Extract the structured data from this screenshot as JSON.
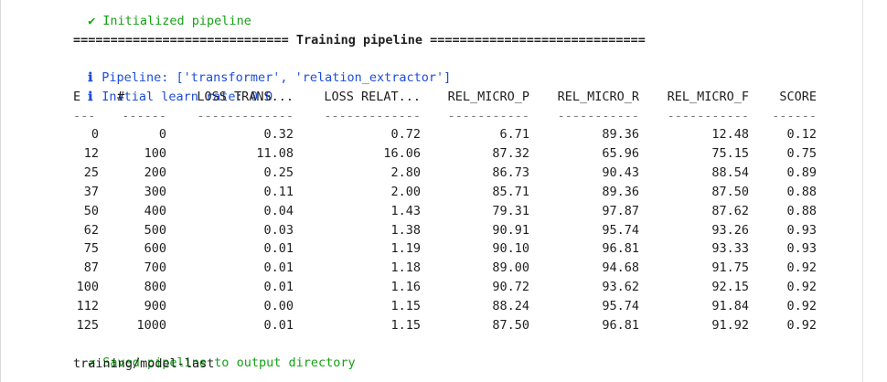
{
  "log": {
    "init_icon": "✔",
    "init_text": "Initialized pipeline",
    "section_header": "============================= Training pipeline =============================",
    "info_icon": "ℹ",
    "pipeline_text": "Pipeline: ['transformer', 'relation_extractor']",
    "learn_rate_text": "Initial learn rate: 0.0",
    "saved_icon": "✔",
    "saved_text": "Saved pipeline to output directory",
    "output_path": "training/model-last",
    "success_color": "#16a116",
    "info_color": "#1d4dd8"
  },
  "table": {
    "headers": [
      "E",
      "#",
      "LOSS TRANS...",
      "LOSS RELAT...",
      "REL_MICRO_P",
      "REL_MICRO_R",
      "REL_MICRO_F",
      "SCORE"
    ],
    "separators": [
      "---",
      "------",
      "-------------",
      "-------------",
      "-----------",
      "-----------",
      "-----------",
      "------"
    ],
    "rows": [
      [
        "0",
        "0",
        "0.32",
        "0.72",
        "6.71",
        "89.36",
        "12.48",
        "0.12"
      ],
      [
        "12",
        "100",
        "11.08",
        "16.06",
        "87.32",
        "65.96",
        "75.15",
        "0.75"
      ],
      [
        "25",
        "200",
        "0.25",
        "2.80",
        "86.73",
        "90.43",
        "88.54",
        "0.89"
      ],
      [
        "37",
        "300",
        "0.11",
        "2.00",
        "85.71",
        "89.36",
        "87.50",
        "0.88"
      ],
      [
        "50",
        "400",
        "0.04",
        "1.43",
        "79.31",
        "97.87",
        "87.62",
        "0.88"
      ],
      [
        "62",
        "500",
        "0.03",
        "1.38",
        "90.91",
        "95.74",
        "93.26",
        "0.93"
      ],
      [
        "75",
        "600",
        "0.01",
        "1.19",
        "90.10",
        "96.81",
        "93.33",
        "0.93"
      ],
      [
        "87",
        "700",
        "0.01",
        "1.18",
        "89.00",
        "94.68",
        "91.75",
        "0.92"
      ],
      [
        "100",
        "800",
        "0.01",
        "1.16",
        "90.72",
        "93.62",
        "92.15",
        "0.92"
      ],
      [
        "112",
        "900",
        "0.00",
        "1.15",
        "88.24",
        "95.74",
        "91.84",
        "0.92"
      ],
      [
        "125",
        "1000",
        "0.01",
        "1.15",
        "87.50",
        "96.81",
        "91.92",
        "0.92"
      ]
    ]
  }
}
